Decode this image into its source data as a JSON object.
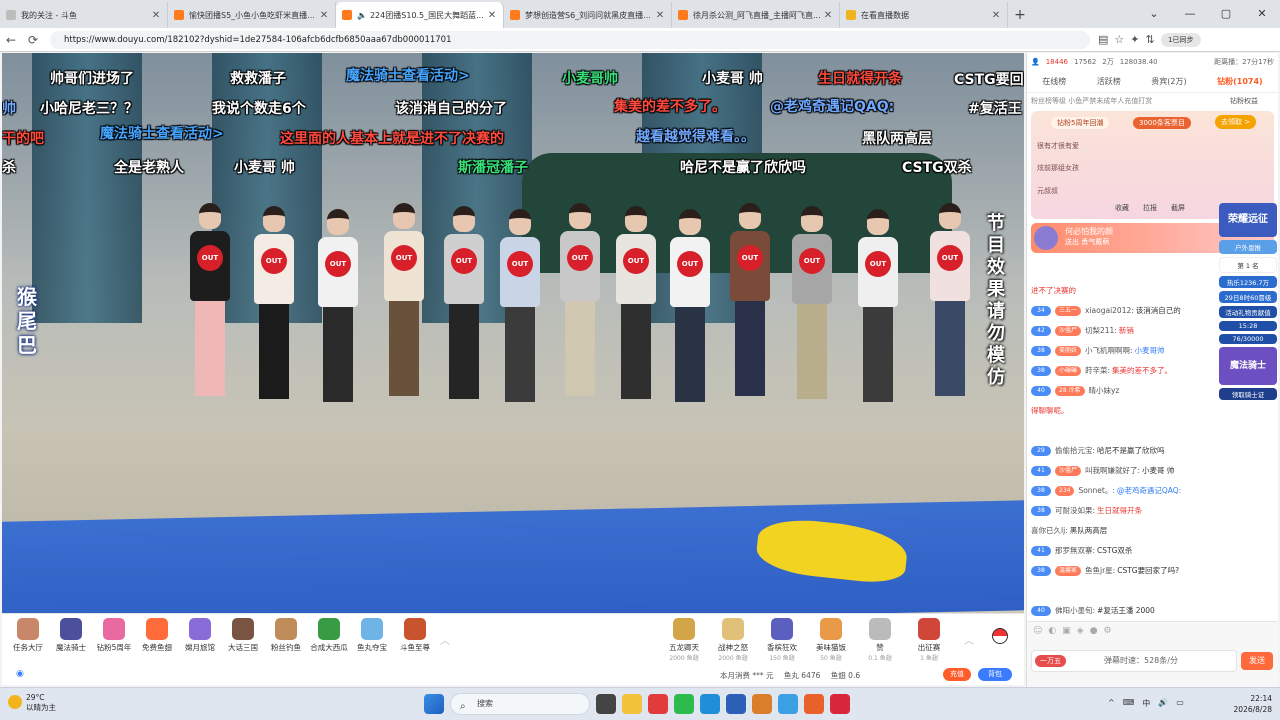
{
  "browser": {
    "tabs": [
      {
        "title": "我的关注 - 斗鱼",
        "favicon_color": "#bdbdbd"
      },
      {
        "title": "愉快团播S5_小鱼小鱼吃虾米直播...",
        "favicon_color": "#ff7a1a"
      },
      {
        "title": "224团播S10.5_国民大舞蹈蓝...",
        "favicon_color": "#ff7a1a",
        "active": true,
        "muted_icon": "🔈"
      },
      {
        "title": "梦想创造营S6_刘问问就黑皮直播...",
        "favicon_color": "#ff7a1a"
      },
      {
        "title": "徐月杀公测_阿飞直播_主播阿飞直...",
        "favicon_color": "#ff7a1a"
      },
      {
        "title": "在看直播数据",
        "favicon_color": "#f2b41e"
      }
    ],
    "new_tab": "+",
    "window_controls": {
      "minimize": "—",
      "maximize": "▢",
      "close": "✕",
      "menu": "⌄"
    },
    "url": "https://www.douyu.com/182102?dyshid=1de27584-106afcb6dcfb6850aaa67db000011701",
    "nav": {
      "back": "←",
      "refresh": "⟳"
    },
    "profile_label": "1已同步"
  },
  "video": {
    "danmaku": [
      {
        "text": "帅哥们进场了",
        "color": "#ffffff"
      },
      {
        "text": "救救潘子",
        "color": "#ffffff"
      },
      {
        "text": "魔法骑士查看活动>",
        "color": "#46a5ff"
      },
      {
        "text": "小麦哥帅",
        "color": "#38e07b"
      },
      {
        "text": "小麦哥 帅",
        "color": "#ffffff"
      },
      {
        "text": "生日就得开条",
        "color": "#ff4a3d"
      },
      {
        "text": "CSTG要回",
        "color": "#ffffff"
      },
      {
        "text": "帅",
        "color": "#6fa8ff"
      },
      {
        "text": "小哈尼老三？？",
        "color": "#ffffff"
      },
      {
        "text": "我说个数走6个",
        "color": "#ffffff"
      },
      {
        "text": "该消消自己的分了",
        "color": "#ffffff"
      },
      {
        "text": "集美的差不多了。",
        "color": "#ff4a3d"
      },
      {
        "text": "@老鸡奇遇记QAQ:",
        "color": "#6fa8ff"
      },
      {
        "text": "#复活王",
        "color": "#ffffff"
      },
      {
        "text": "干的吧",
        "color": "#ff4a3d"
      },
      {
        "text": "魔法骑士查看活动>",
        "color": "#46a5ff"
      },
      {
        "text": "这里面的人基本上就是进不了决赛的",
        "color": "#ff4a3d"
      },
      {
        "text": "越看越觉得难看。。",
        "color": "#6fa8ff"
      },
      {
        "text": "黑队两高层",
        "color": "#ffffff"
      },
      {
        "text": "杀",
        "color": "#ffffff"
      },
      {
        "text": "全是老熟人",
        "color": "#ffffff"
      },
      {
        "text": "小麦哥 帅",
        "color": "#ffffff"
      },
      {
        "text": "斯潘冠潘子",
        "color": "#38e07b"
      },
      {
        "text": "哈尼不是赢了欣欣吗",
        "color": "#ffffff"
      },
      {
        "text": "CSTG双杀",
        "color": "#ffffff"
      }
    ],
    "left_vertical": "猴尾巴",
    "right_vertical": "节目效果 请勿模仿",
    "out_label": "OUT"
  },
  "gifts": [
    {
      "label": "任务大厅",
      "color": "#c9876a"
    },
    {
      "label": "魔法骑士",
      "color": "#4b4f9c"
    },
    {
      "label": "钻粉5周年",
      "color": "#e86aa0"
    },
    {
      "label": "免费鱼翅",
      "color": "#ff6b3a"
    },
    {
      "label": "嫦月旅馆",
      "color": "#8a6cd8"
    },
    {
      "label": "大话三国",
      "color": "#7a5442"
    },
    {
      "label": "粉丝钓鱼",
      "color": "#c08d5a"
    },
    {
      "label": "合成大西瓜",
      "color": "#3a9b45"
    },
    {
      "label": "鱼丸夺宝",
      "color": "#6fb4e6"
    },
    {
      "label": "斗鱼至尊",
      "color": "#c9532d"
    }
  ],
  "paid_gifts": [
    {
      "label": "五龙卿天",
      "price": "2000 鱼翅",
      "color": "#d2a548"
    },
    {
      "label": "战神之怒",
      "price": "2000 鱼翅",
      "color": "#e1c07a"
    },
    {
      "label": "香槟狂欢",
      "price": "150 鱼翅",
      "color": "#5b5fbd"
    },
    {
      "label": "美味猫饭",
      "price": "50 鱼翅",
      "color": "#e99a48"
    },
    {
      "label": "赞",
      "price": "0.1 鱼翅",
      "color": "#bbbbbb"
    },
    {
      "label": "出征赛",
      "price": "1 鱼翅",
      "color": "#d0473a"
    }
  ],
  "wallet": {
    "consume": "本月消费 *** 元",
    "fishball": "鱼丸 6476",
    "fishfin": "鱼翅 0.6",
    "recharge": "充值",
    "backpack": "背包"
  },
  "panel": {
    "stats": [
      "18446",
      "17562",
      "2万",
      "128038.40"
    ],
    "timer": "距离播：27分17秒",
    "tabs": [
      "在线榜",
      "活跃榜",
      "贵宾(2万)",
      "钻粉(1074)"
    ],
    "active_tab": 3,
    "fans_line": "粉丝榜等级 小鱼严禁未成年人充值打赏",
    "fans_link": "钻粉权益",
    "promo": {
      "t1": "钻粉5周年回潮",
      "t2": "3000条客票目",
      "t3": "去领取 >"
    },
    "ranks": [
      "很有才很有爱",
      "炫前那组女孩",
      "元叔叔"
    ],
    "controls": [
      "收藏",
      "拉报",
      "截屏"
    ],
    "gift_notice": {
      "name": "何必怕我的颜",
      "text": "送出 勇气戴萌"
    },
    "badges": {
      "b1": "荣耀远征",
      "b2": "户外恩推",
      "rank_num": "第 1 名",
      "b3": "热乐1236.7万",
      "b4": "29日8时60冒级",
      "b5": "活动礼物贡献值",
      "b6": "15:28",
      "b7": "76/30000",
      "b8": "魔法骑士",
      "b9": "领取骑士证"
    },
    "chat": [
      {
        "lv": "",
        "fan": "",
        "name": "进不了决赛的",
        "text": "",
        "cls": "hl-red"
      },
      {
        "lv": "34",
        "fan": "三五一",
        "name": "xiaogai2012:",
        "text": "该消消自己的",
        "cls": ""
      },
      {
        "lv": "42",
        "fan": "沙僵尸",
        "name": "切梨211:",
        "text": "新销",
        "cls": "hl-red"
      },
      {
        "lv": "38",
        "fan": "美丽妖",
        "name": "小飞机啊啊啊:",
        "text": "小麦哥帅",
        "cls": "hl-blue"
      },
      {
        "lv": "38",
        "fan": "小碾碾",
        "name": "莳辛菜:",
        "text": "集美的差不多了。",
        "cls": "hl-red"
      },
      {
        "lv": "40",
        "fan": "28 冷希",
        "name": "晴小妹yz",
        "text": "",
        "cls": ""
      },
      {
        "lv": "",
        "fan": "",
        "name": "得聊聊呢。",
        "text": "",
        "cls": "hl-red"
      },
      {
        "lv": "",
        "fan": "",
        "name": "",
        "text": "",
        "cls": ""
      },
      {
        "lv": "29",
        "fan": "",
        "name": "偷偷拾元宝:",
        "text": "哈尼不是赢了欣欣吗",
        "cls": ""
      },
      {
        "lv": "41",
        "fan": "沙僵尸",
        "name": "叫我啊嫌就好了:",
        "text": "小麦哥 帅",
        "cls": ""
      },
      {
        "lv": "38",
        "fan": "234",
        "name": "Sonnet。:",
        "text": "@老鸡奇遇记QAQ:",
        "cls": "hl-blue"
      },
      {
        "lv": "38",
        "fan": "",
        "name": "可耐没如果:",
        "text": "生日就得开条",
        "cls": "hl-red"
      },
      {
        "lv": "",
        "fan": "",
        "name": "喜你已久lj:",
        "text": "黑队两高层",
        "cls": ""
      },
      {
        "lv": "41",
        "fan": "",
        "name": "那罗無双寨:",
        "text": "CSTG双杀",
        "cls": ""
      },
      {
        "lv": "38",
        "fan": "温馨家",
        "name": "鱼鱼jr星:",
        "text": "CSTG要回家了吗?",
        "cls": ""
      },
      {
        "lv": "",
        "fan": "",
        "name": "",
        "text": "",
        "cls": ""
      },
      {
        "lv": "40",
        "fan": "",
        "name": "佛阳小墨旬:",
        "text": "#复活王潘 2000",
        "cls": ""
      }
    ],
    "input": {
      "badge": "一万五",
      "countdown": "弹幕时速：528条/分",
      "send": "发送"
    }
  },
  "taskbar": {
    "temp": "29°C",
    "weather": "以晴为主",
    "search": "搜索",
    "tray": [
      "^",
      "⌨",
      "中",
      "🔊",
      "▭"
    ],
    "time": "22:14",
    "date": "2026/8/28"
  }
}
